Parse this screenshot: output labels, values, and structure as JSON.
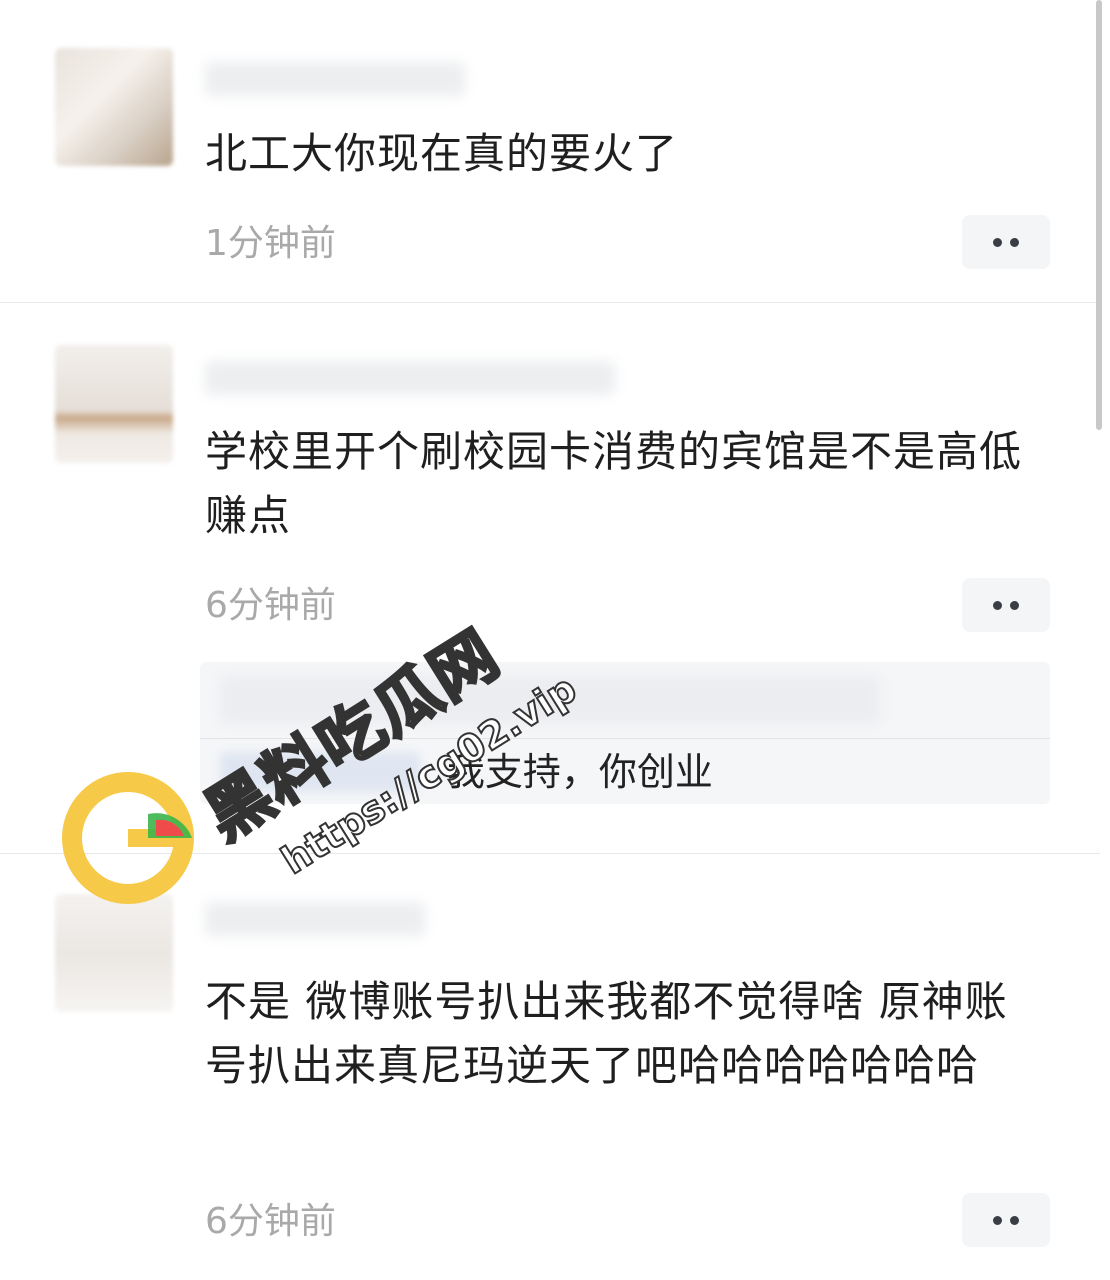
{
  "comments": [
    {
      "text": "北工大你现在真的要火了",
      "time": "1分钟前"
    },
    {
      "text": "学校里开个刷校园卡消费的宾馆是不是高低赚点",
      "time": "6分钟前",
      "reply": {
        "separator": ": ",
        "text": "我支持，你创业"
      }
    },
    {
      "text": "不是 微博账号扒出来我都不觉得啥 原神账号扒出来真尼玛逆天了吧哈哈哈哈哈哈哈",
      "time": "6分钟前"
    }
  ],
  "watermark": {
    "title": "黑料吃瓜网",
    "url": "https://cg02.vip"
  },
  "colors": {
    "accent_orange": "#f7c948",
    "watermelon_green": "#3bb54a",
    "watermelon_red": "#ef4b4b"
  }
}
